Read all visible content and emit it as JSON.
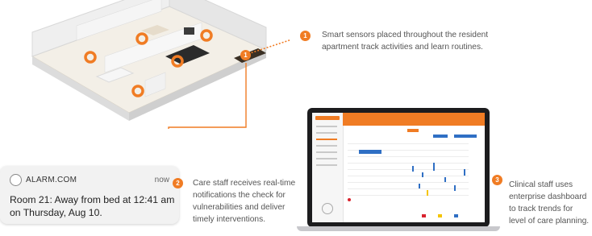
{
  "callouts": [
    {
      "number": "1",
      "text": "Smart sensors placed throughout the resident apartment track activities and learn routines."
    },
    {
      "number": "2",
      "text": "Care staff receives real-time notifications the check for vulnerabilities and deliver timely interventions."
    },
    {
      "number": "3",
      "text": "Clinical staff uses enterprise dashboard to track trends for level of care planning."
    }
  ],
  "notification": {
    "app_name": "ALARM.COM",
    "time": "now",
    "message": "Room 21: Away from bed at 12:41 am on Thursday, Aug 10."
  },
  "colors": {
    "accent": "#f07c24",
    "dashboard_blue": "#2f6fc4",
    "dashboard_yellow": "#f5c400",
    "dashboard_red": "#d9232e"
  },
  "icons": [
    "alarm-logo-icon",
    "sensor-ring-icon"
  ]
}
